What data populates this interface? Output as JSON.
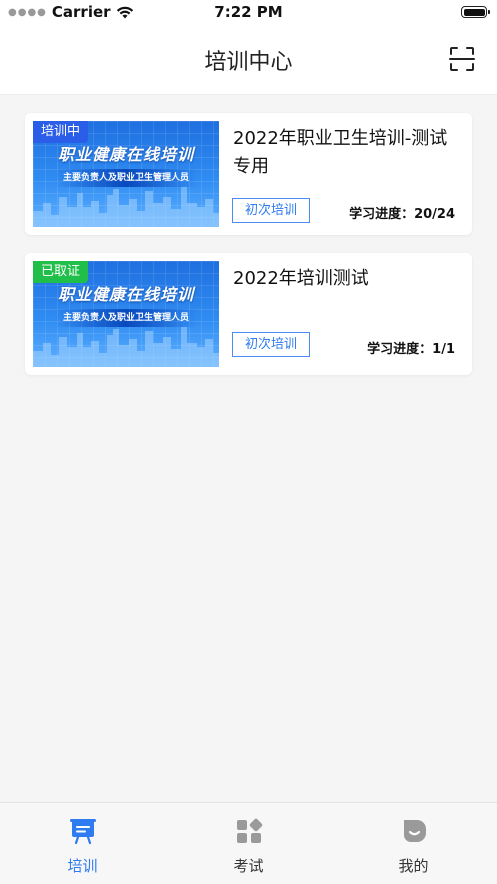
{
  "status_bar": {
    "carrier": "Carrier",
    "time": "7:22 PM"
  },
  "nav": {
    "title": "培训中心",
    "scan_icon": "scan-icon"
  },
  "courses": [
    {
      "badge": "培训中",
      "badge_color": "#2b5ee8",
      "thumb_heading": "职业健康在线培训",
      "thumb_sub": "主要负责人及职业卫生管理人员",
      "title": "2022年职业卫生培训-测试专用",
      "type": "初次培训",
      "progress": "学习进度：20/24"
    },
    {
      "badge": "已取证",
      "badge_color": "#1fbf4a",
      "thumb_heading": "职业健康在线培训",
      "thumb_sub": "主要负责人及职业卫生管理人员",
      "title": "2022年培训测试",
      "type": "初次培训",
      "progress": "学习进度：1/1"
    }
  ],
  "tabs": [
    {
      "label": "培训",
      "icon": "training-board-icon",
      "active": true
    },
    {
      "label": "考试",
      "icon": "exam-grid-icon",
      "active": false
    },
    {
      "label": "我的",
      "icon": "profile-icon",
      "active": false
    }
  ],
  "colors": {
    "accent": "#2f7bf0",
    "badge_blue": "#2b5ee8",
    "badge_green": "#1fbf4a"
  }
}
